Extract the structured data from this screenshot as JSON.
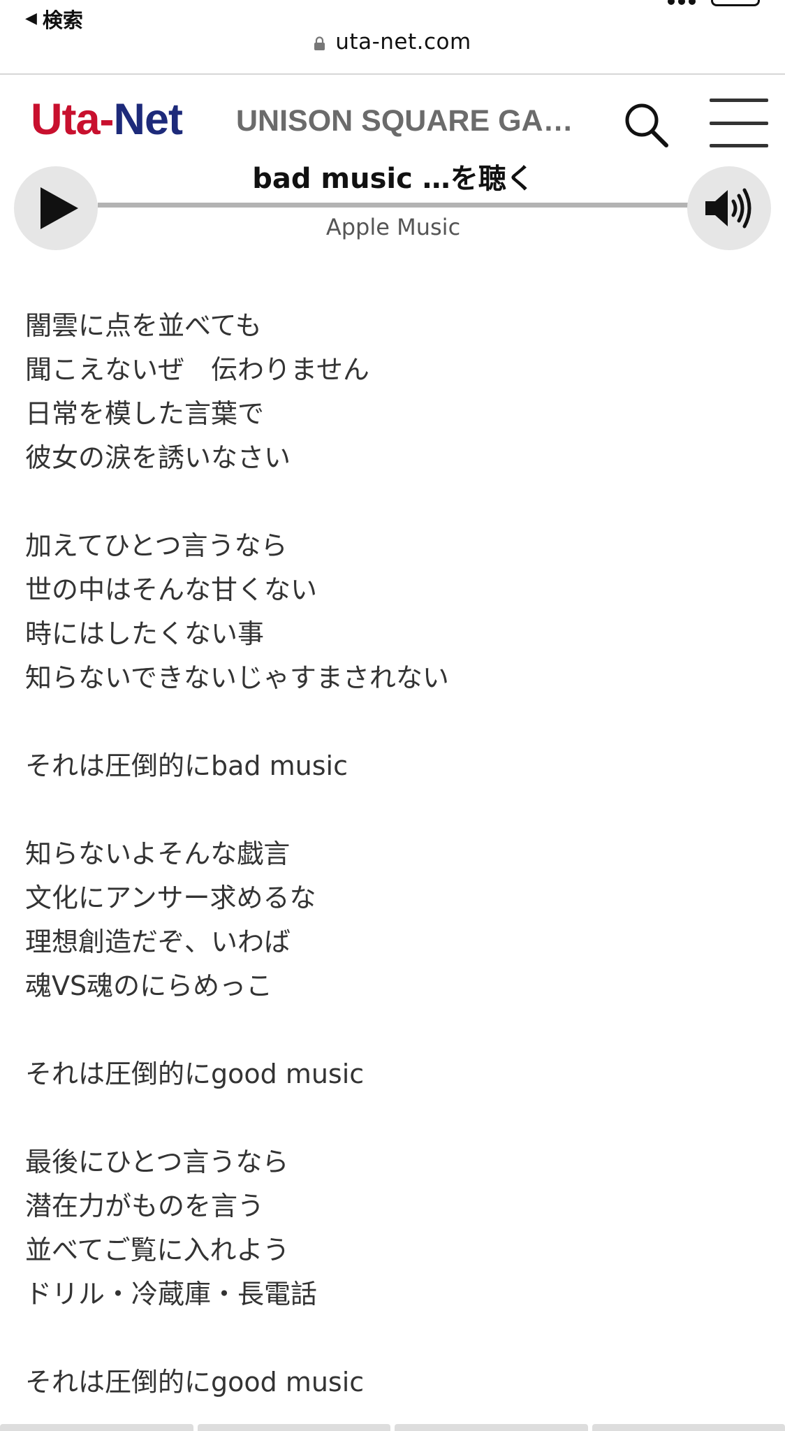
{
  "browser": {
    "back_label": "検索",
    "url": "uta-net.com"
  },
  "header": {
    "logo": {
      "part1": "Uta",
      "dash": "-",
      "part2": "Net"
    },
    "artist": "UNISON SQUARE GA…"
  },
  "player": {
    "title": "bad music …を聴く",
    "source": "Apple Music",
    "progress": 0
  },
  "lyrics": {
    "stanzas": [
      [
        "闇雲に点を並べても",
        "聞こえないぜ　伝わりません",
        "日常を模した言葉で",
        "彼女の涙を誘いなさい"
      ],
      [
        "加えてひとつ言うなら",
        "世の中はそんな甘くない",
        "時にはしたくない事",
        "知らないできないじゃすまされない"
      ],
      [
        "それは圧倒的にbad music"
      ],
      [
        "知らないよそんな戯言",
        "文化にアンサー求めるな",
        "理想創造だぞ、いわば",
        "魂VS魂のにらめっこ"
      ],
      [
        "それは圧倒的にgood music"
      ],
      [
        "最後にひとつ言うなら",
        "潜在力がものを言う",
        "並べてご覧に入れよう",
        "ドリル・冷蔵庫・長電話"
      ],
      [
        "それは圧倒的にgood music"
      ]
    ]
  },
  "colors": {
    "logo_red": "#c8102e",
    "logo_navy": "#1d2a7a",
    "text": "#333333"
  }
}
